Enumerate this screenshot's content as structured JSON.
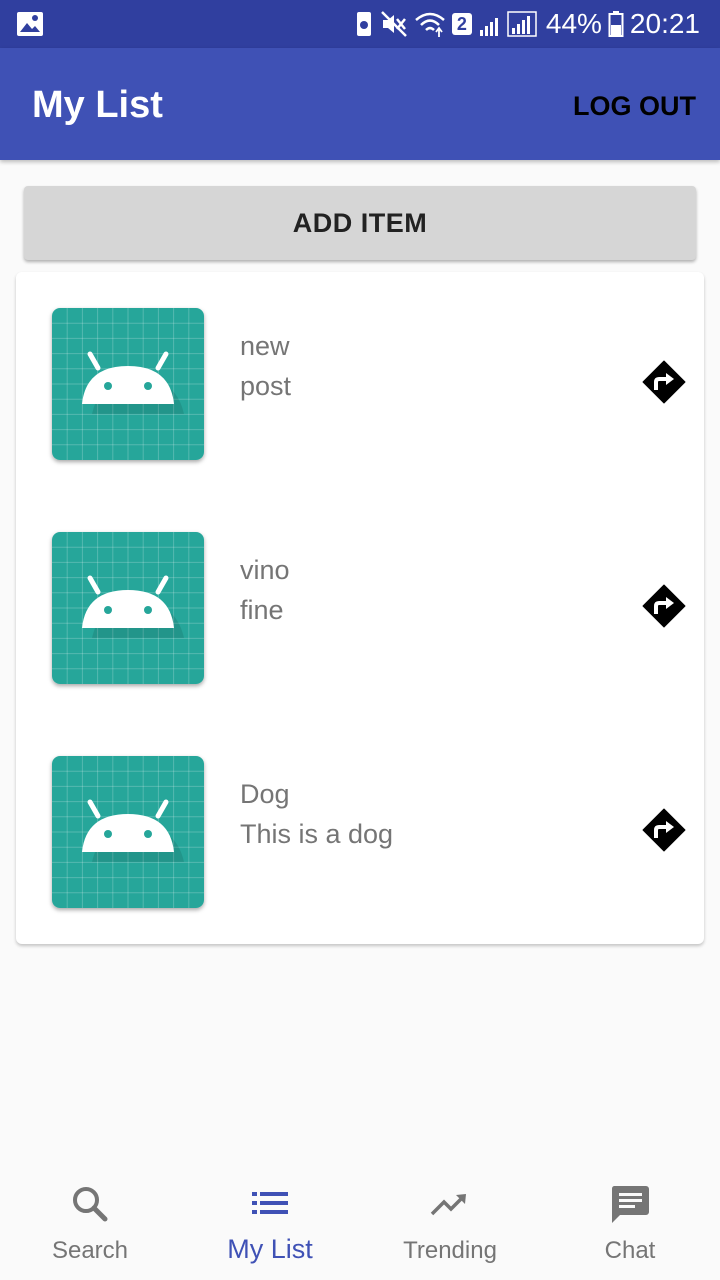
{
  "status_bar": {
    "sim_badge": "2",
    "battery": "44%",
    "time": "20:21"
  },
  "app_bar": {
    "title": "My List",
    "logout_label": "LOG OUT"
  },
  "add_item_label": "ADD ITEM",
  "items": [
    {
      "title": "new",
      "subtitle": "post",
      "icon": "android-placeholder-icon"
    },
    {
      "title": "vino",
      "subtitle": "fine",
      "icon": "android-placeholder-icon"
    },
    {
      "title": "Dog",
      "subtitle": "This is a dog",
      "icon": "android-placeholder-icon"
    }
  ],
  "bottom_nav": [
    {
      "label": "Search",
      "icon": "search-icon",
      "active": false
    },
    {
      "label": "My List",
      "icon": "list-icon",
      "active": true
    },
    {
      "label": "Trending",
      "icon": "trending-icon",
      "active": false
    },
    {
      "label": "Chat",
      "icon": "chat-icon",
      "active": false
    }
  ],
  "colors": {
    "status_bar": "#303f9f",
    "primary": "#3f51b5",
    "thumb_teal": "#26a69a",
    "text_secondary": "#757575"
  }
}
